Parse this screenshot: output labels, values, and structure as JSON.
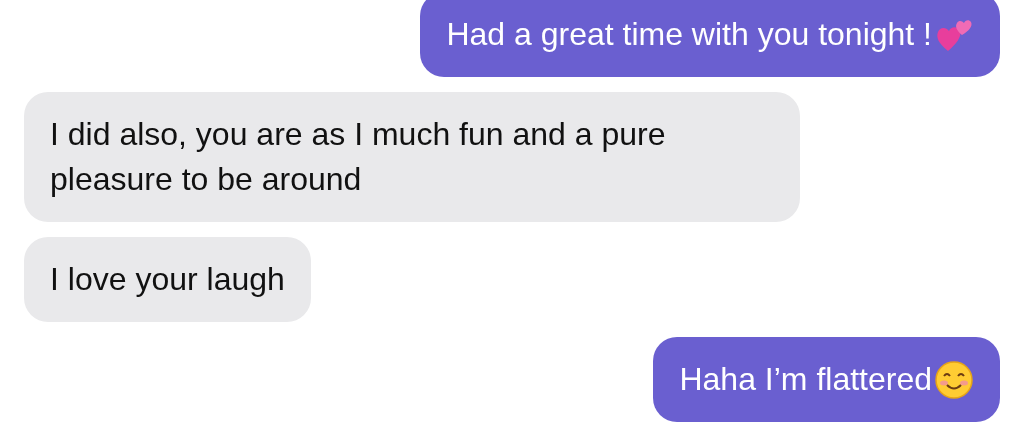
{
  "messages": [
    {
      "kind": "sent",
      "text": "Had a great time with you tonight !",
      "emoji": {
        "kind": "hearts"
      }
    },
    {
      "kind": "received",
      "text": "I did also, you are as I much fun and a pure pleasure to be around"
    },
    {
      "kind": "received",
      "text": "I love your laugh"
    },
    {
      "kind": "sent",
      "text": "Haha I’m flattered",
      "emoji": {
        "kind": "smile"
      }
    }
  ]
}
